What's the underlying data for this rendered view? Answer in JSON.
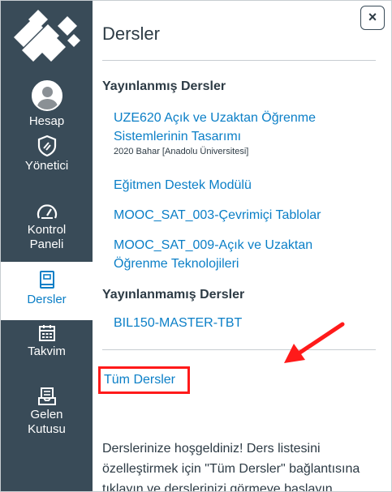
{
  "sidebar": {
    "items": [
      {
        "label": "Hesap",
        "icon": "user-avatar-icon"
      },
      {
        "label": "Yönetici",
        "icon": "shield-icon"
      },
      {
        "label": "Kontrol Paneli",
        "icon": "dashboard-gauge-icon"
      },
      {
        "label": "Dersler",
        "icon": "book-icon",
        "active": true
      },
      {
        "label": "Takvim",
        "icon": "calendar-icon"
      },
      {
        "label": "Gelen Kutusu",
        "icon": "inbox-icon"
      }
    ],
    "colors": {
      "background": "#394b58",
      "active_text": "#0b7fc7"
    }
  },
  "panel": {
    "close_label": "×",
    "title": "Dersler",
    "published_heading": "Yayınlanmış Dersler",
    "published": [
      {
        "name": "UZE620 Açık ve Uzaktan Öğrenme Sistemlerinin Tasarımı",
        "term": "2020 Bahar [Anadolu Üniversitesi]"
      },
      {
        "name": "Eğitmen Destek Modülü"
      },
      {
        "name": "MOOC_SAT_003-Çevrimiçi Tablolar"
      },
      {
        "name": "MOOC_SAT_009-Açık ve Uzaktan Öğrenme Teknolojileri"
      }
    ],
    "unpublished_heading": "Yayınlanmamış Dersler",
    "unpublished": [
      {
        "name": "BIL150-MASTER-TBT"
      }
    ],
    "all_courses_label": "Tüm Dersler",
    "welcome_text": "Derslerinize hoşgeldiniz! Ders listesini özelleştirmek için \"Tüm Dersler\" bağlantısına tıklayın ve derslerinizi görmeye başlayın.",
    "colors": {
      "link": "#0b7fc7",
      "highlight": "#ff1a1a",
      "text": "#2d3b45"
    }
  }
}
